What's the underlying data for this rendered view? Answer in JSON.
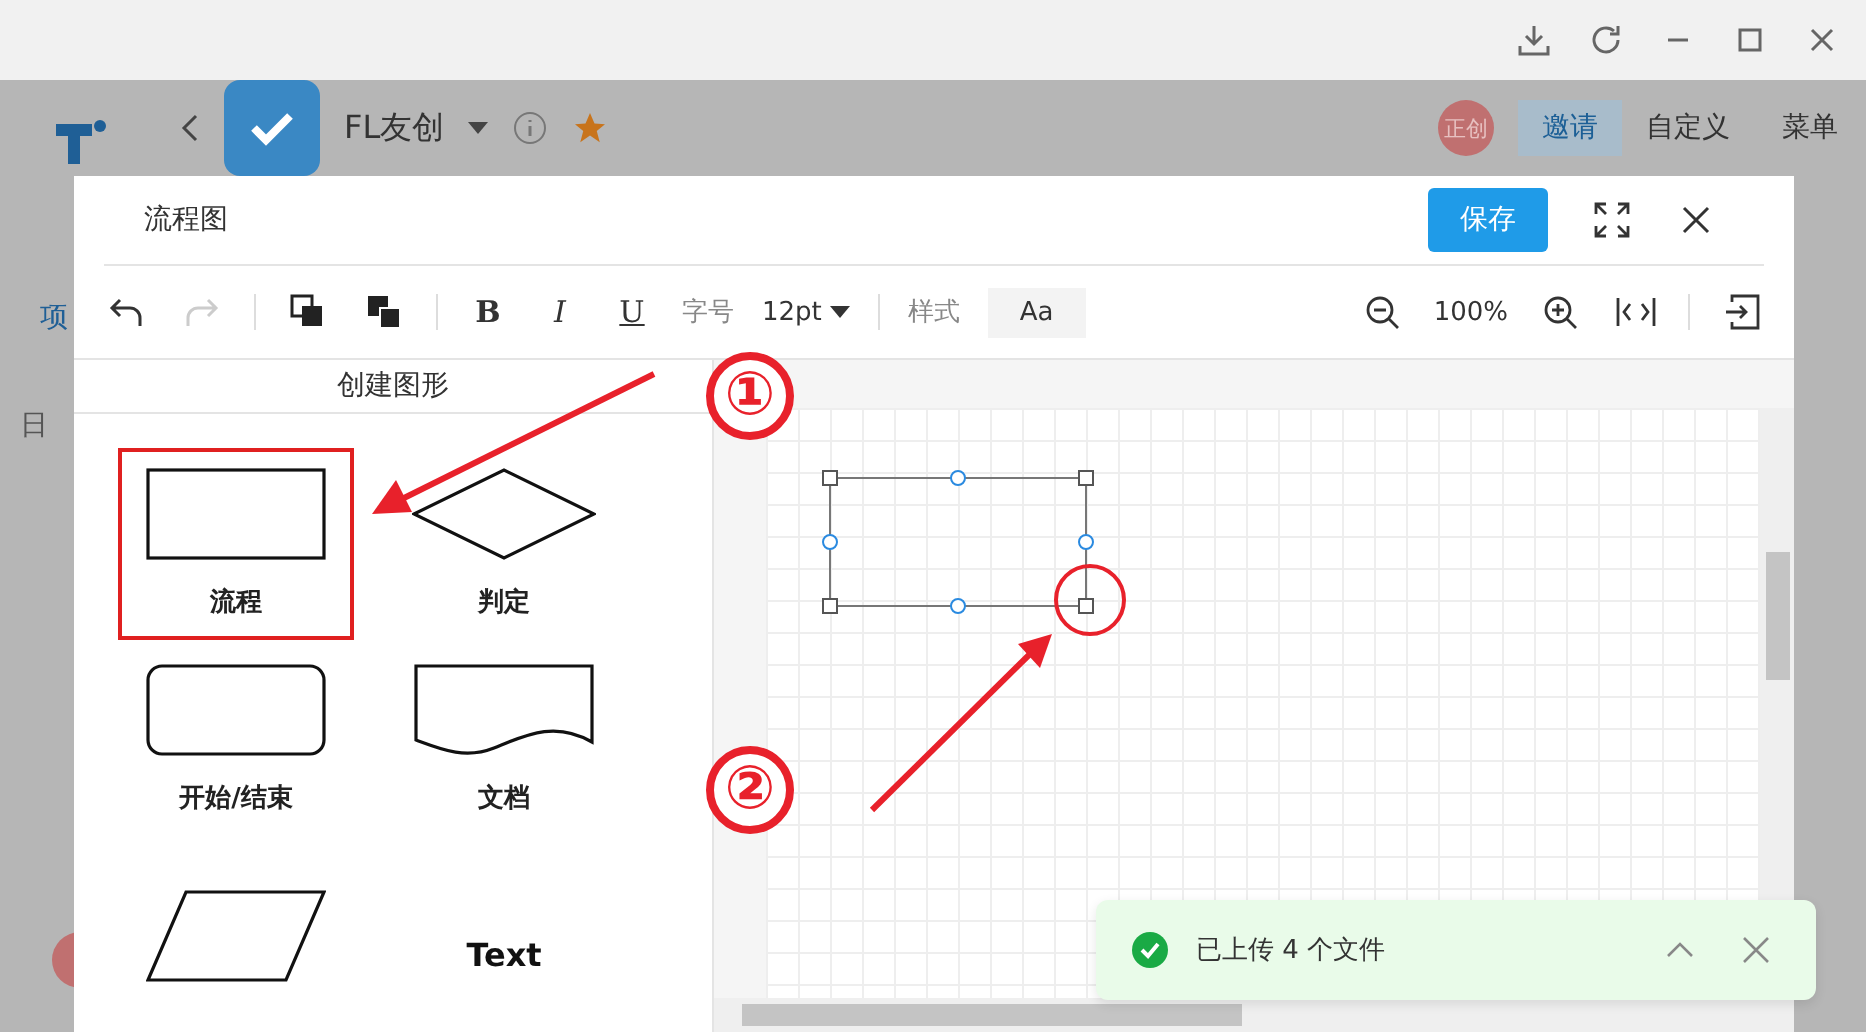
{
  "background_app": {
    "project_name": "FL友创",
    "avatar_text": "正创",
    "invite_button": "邀请",
    "customize": "自定义",
    "menu": "菜单",
    "sidebar_items": [
      "项",
      "日"
    ]
  },
  "dialog": {
    "title": "流程图",
    "save_button": "保存",
    "toolbar": {
      "history": [
        {
          "kind": "undo",
          "disabled": false
        },
        {
          "kind": "redo",
          "disabled": true
        }
      ],
      "format_buttons": [
        "B",
        "I",
        "U"
      ],
      "font_size_label": "字号",
      "font_size": "12pt",
      "style_label": "样式",
      "style_value": "Aa",
      "zoom": "100%"
    },
    "shape_panel": {
      "title": "创建图形",
      "shapes": [
        {
          "kind": "process",
          "label": "流程",
          "highlighted": true
        },
        {
          "kind": "decision",
          "label": "判定",
          "highlighted": false
        },
        {
          "kind": "terminator",
          "label": "开始/结束",
          "highlighted": false
        },
        {
          "kind": "document",
          "label": "文档",
          "highlighted": false
        },
        {
          "kind": "data",
          "highlighted": false
        },
        {
          "kind": "text",
          "label": "Text",
          "highlighted": false
        }
      ]
    }
  },
  "annotations": [
    "①",
    "②"
  ],
  "toast": {
    "message": "已上传 4 个文件"
  }
}
